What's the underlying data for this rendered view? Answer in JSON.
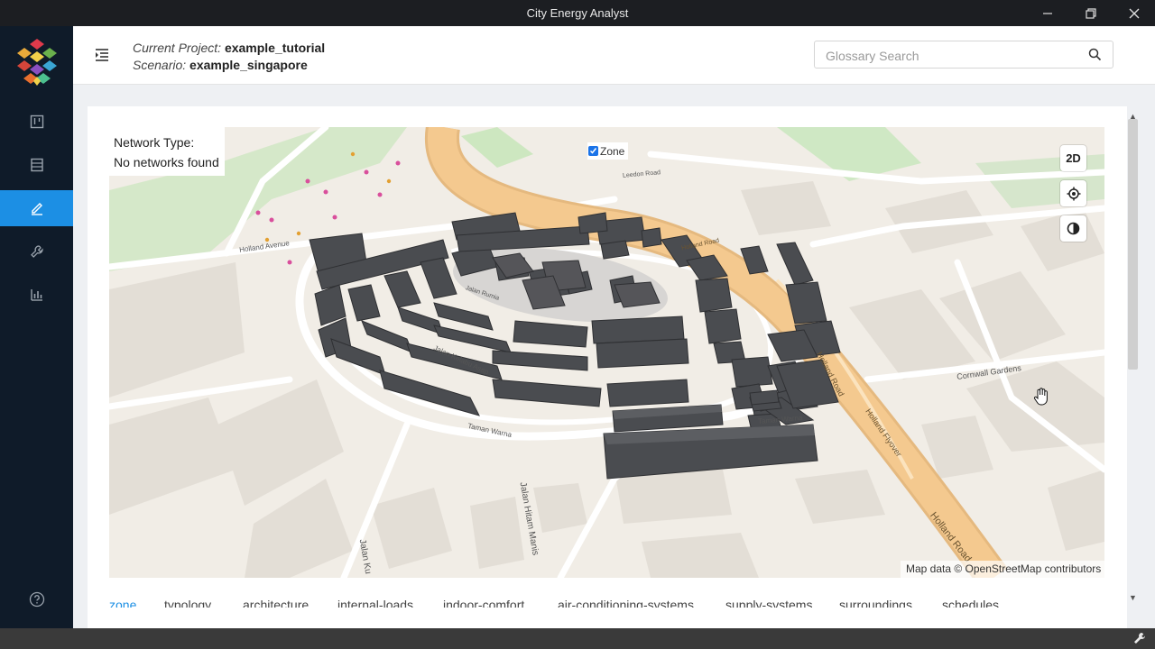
{
  "window": {
    "title": "City Energy Analyst"
  },
  "header": {
    "project_label": "Current Project:",
    "project_name": "example_tutorial",
    "scenario_label": "Scenario:",
    "scenario_name": "example_singapore",
    "search_placeholder": "Glossary Search"
  },
  "sidebar": {
    "items": [
      "project-icon",
      "database-icon",
      "edit-icon",
      "tools-icon",
      "dashboard-icon"
    ],
    "active": "edit-icon",
    "help": "help-icon"
  },
  "map": {
    "network_type_label": "Network Type:",
    "network_status": "No networks found",
    "layer_label": "Zone",
    "layer_checked": true,
    "view_mode_button": "2D",
    "attribution": "Map data © OpenStreetMap contributors",
    "street_labels": [
      "Holland Avenue",
      "Jalan Kelabu Asap",
      "Taman Warna",
      "Taman Warna",
      "Jalan Hitam Manis",
      "Jalan Ku",
      "Holland Road",
      "Holland Road",
      "Holland Flyover",
      "Holland Road",
      "Cornwall Gardens",
      "Leedon Road",
      "Jalan Rumia"
    ]
  },
  "tabs": {
    "active": "zone",
    "items": [
      "zone",
      "typology",
      "architecture",
      "internal-loads",
      "indoor-comfort",
      "air-conditioning-systems",
      "supply-systems",
      "surroundings",
      "schedules"
    ]
  },
  "colors": {
    "accent": "#1c8fe4",
    "sidebar": "#0f1b29",
    "titlebar": "#1c1e22",
    "road_major": "#f4c98f",
    "building": "#4a4c50"
  }
}
